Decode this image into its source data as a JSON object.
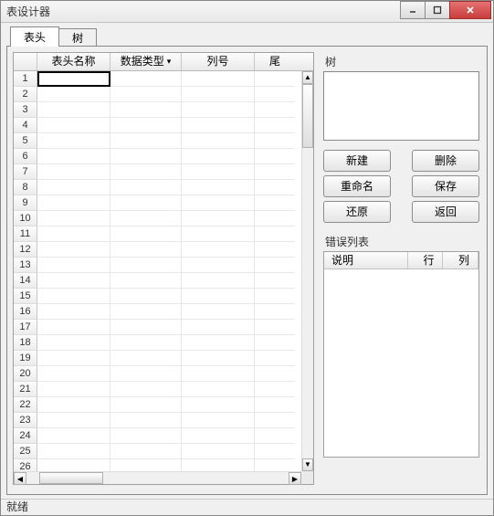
{
  "window": {
    "title": "表设计器"
  },
  "winbuttons": {
    "min": "min",
    "max": "max",
    "close": "close"
  },
  "tabs": [
    {
      "label": "表头",
      "active": true
    },
    {
      "label": "树",
      "active": false
    }
  ],
  "grid": {
    "columns": [
      {
        "key": "name",
        "label": "表头名称"
      },
      {
        "key": "type",
        "label": "数据类型",
        "dropdown": true
      },
      {
        "key": "colno",
        "label": "列号"
      },
      {
        "key": "extra",
        "label": "尾"
      }
    ],
    "row_count": 26,
    "selected_row": 1
  },
  "right": {
    "tree_label": "树",
    "buttons": {
      "new": "新建",
      "delete": "删除",
      "rename": "重命名",
      "save": "保存",
      "restore": "还原",
      "back": "返回"
    },
    "error_list_label": "错误列表",
    "error_cols": {
      "desc": "说明",
      "row": "行",
      "col": "列"
    }
  },
  "status": {
    "text": "就绪"
  }
}
